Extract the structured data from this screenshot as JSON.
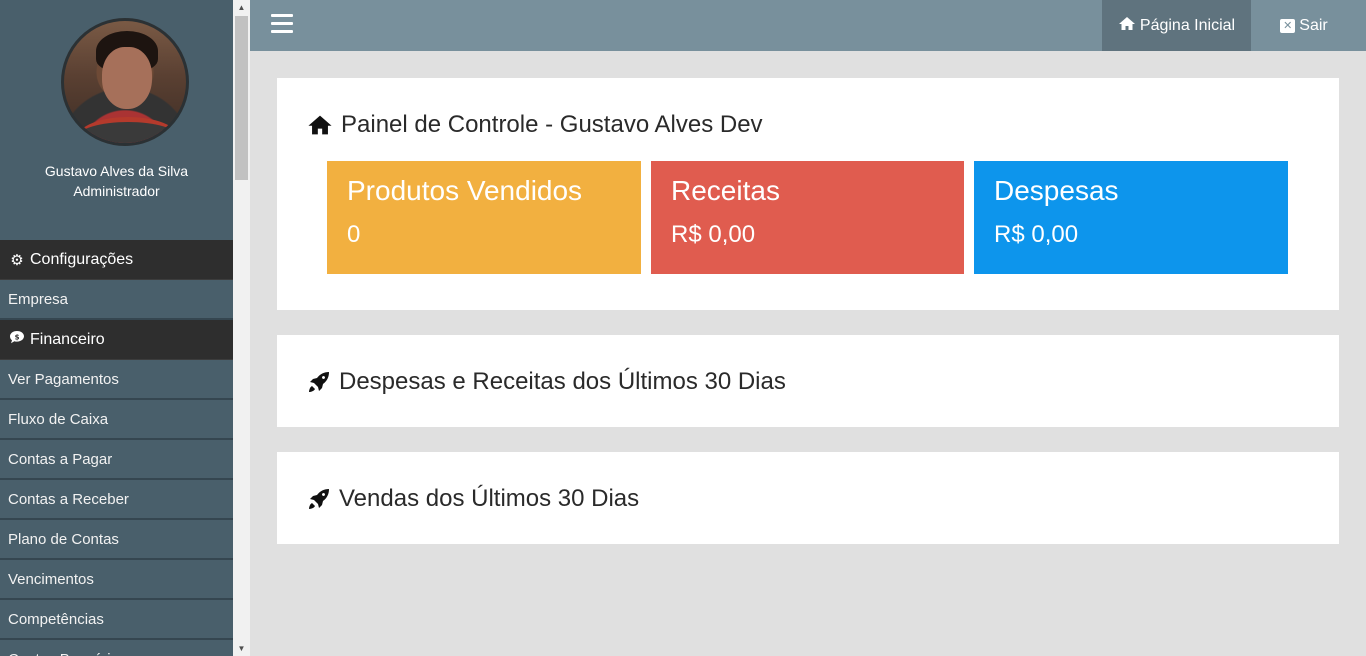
{
  "colors": {
    "sidebar": "#495f6b",
    "sidebar_header": "#2e2e2e",
    "topbar": "#78909c",
    "card_orange": "#f2b040",
    "card_red": "#e05c4f",
    "card_blue": "#0d95ec"
  },
  "profile": {
    "name": "Gustavo Alves da Silva",
    "role": "Administrador"
  },
  "sidebar": {
    "sections": [
      {
        "header": "Configurações",
        "icon": "gear-icon",
        "items": [
          "Empresa"
        ]
      },
      {
        "header": "Financeiro",
        "icon": "money-icon",
        "items": [
          "Ver Pagamentos",
          "Fluxo de Caixa",
          "Contas a Pagar",
          "Contas a Receber",
          "Plano de Contas",
          "Vencimentos",
          "Competências",
          "Contas Bancárias"
        ]
      }
    ]
  },
  "topbar": {
    "home_label": "Página Inicial",
    "home_icon": "home-icon",
    "logout_label": "Sair",
    "logout_icon": "close-box-icon"
  },
  "dashboard": {
    "title": "Painel de Controle - Gustavo Alves Dev",
    "cards": [
      {
        "title": "Produtos Vendidos",
        "value": "0"
      },
      {
        "title": "Receitas",
        "value": "R$ 0,00"
      },
      {
        "title": "Despesas",
        "value": "R$ 0,00"
      }
    ]
  },
  "panels": {
    "expenses_income_title": "Despesas e Receitas dos Últimos 30 Dias",
    "sales_title": "Vendas dos Últimos 30 Dias"
  }
}
